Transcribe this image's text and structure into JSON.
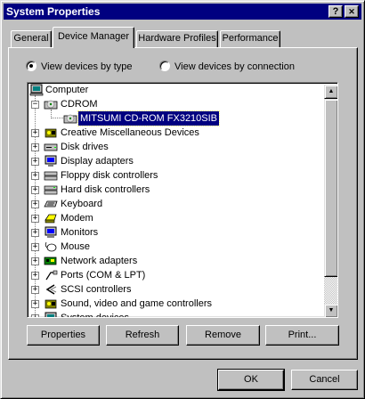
{
  "window": {
    "title": "System Properties",
    "help_glyph": "?",
    "close_glyph": "✕"
  },
  "tabs": [
    {
      "label": "General",
      "active": false
    },
    {
      "label": "Device Manager",
      "active": true
    },
    {
      "label": "Hardware Profiles",
      "active": false
    },
    {
      "label": "Performance",
      "active": false
    }
  ],
  "view": {
    "by_type_label": "View devices by type",
    "by_connection_label": "View devices by connection",
    "selected": "by_type"
  },
  "tree": {
    "items": [
      {
        "label": "Computer",
        "icon": "computer-icon",
        "expander": "",
        "level": 0
      },
      {
        "label": "CDROM",
        "icon": "cdrom-icon",
        "expander": "−",
        "level": 1
      },
      {
        "label": "MITSUMI CD-ROM FX3210SIB",
        "icon": "cdrom-icon",
        "expander": "",
        "level": 2,
        "selected": true
      },
      {
        "label": "Creative Miscellaneous Devices",
        "icon": "sound-icon",
        "expander": "+",
        "level": 1
      },
      {
        "label": "Disk drives",
        "icon": "disk-drive-icon",
        "expander": "+",
        "level": 1
      },
      {
        "label": "Display adapters",
        "icon": "display-icon",
        "expander": "+",
        "level": 1
      },
      {
        "label": "Floppy disk controllers",
        "icon": "floppy-controller-icon",
        "expander": "+",
        "level": 1
      },
      {
        "label": "Hard disk controllers",
        "icon": "hdd-controller-icon",
        "expander": "+",
        "level": 1
      },
      {
        "label": "Keyboard",
        "icon": "keyboard-icon",
        "expander": "+",
        "level": 1
      },
      {
        "label": "Modem",
        "icon": "modem-icon",
        "expander": "+",
        "level": 1
      },
      {
        "label": "Monitors",
        "icon": "monitor-icon",
        "expander": "+",
        "level": 1
      },
      {
        "label": "Mouse",
        "icon": "mouse-icon",
        "expander": "+",
        "level": 1
      },
      {
        "label": "Network adapters",
        "icon": "network-icon",
        "expander": "+",
        "level": 1
      },
      {
        "label": "Ports (COM & LPT)",
        "icon": "port-icon",
        "expander": "+",
        "level": 1
      },
      {
        "label": "SCSI controllers",
        "icon": "scsi-icon",
        "expander": "+",
        "level": 1
      },
      {
        "label": "Sound, video and game controllers",
        "icon": "sound-icon",
        "expander": "+",
        "level": 1
      },
      {
        "label": "System devices",
        "icon": "computer-icon",
        "expander": "+",
        "level": 1
      }
    ]
  },
  "buttons": {
    "properties": "Properties",
    "refresh": "Refresh",
    "remove": "Remove",
    "print": "Print...",
    "ok": "OK",
    "cancel": "Cancel"
  },
  "colors": {
    "title_bar": "#000080",
    "face": "#c0c0c0",
    "selection": "#000080"
  }
}
